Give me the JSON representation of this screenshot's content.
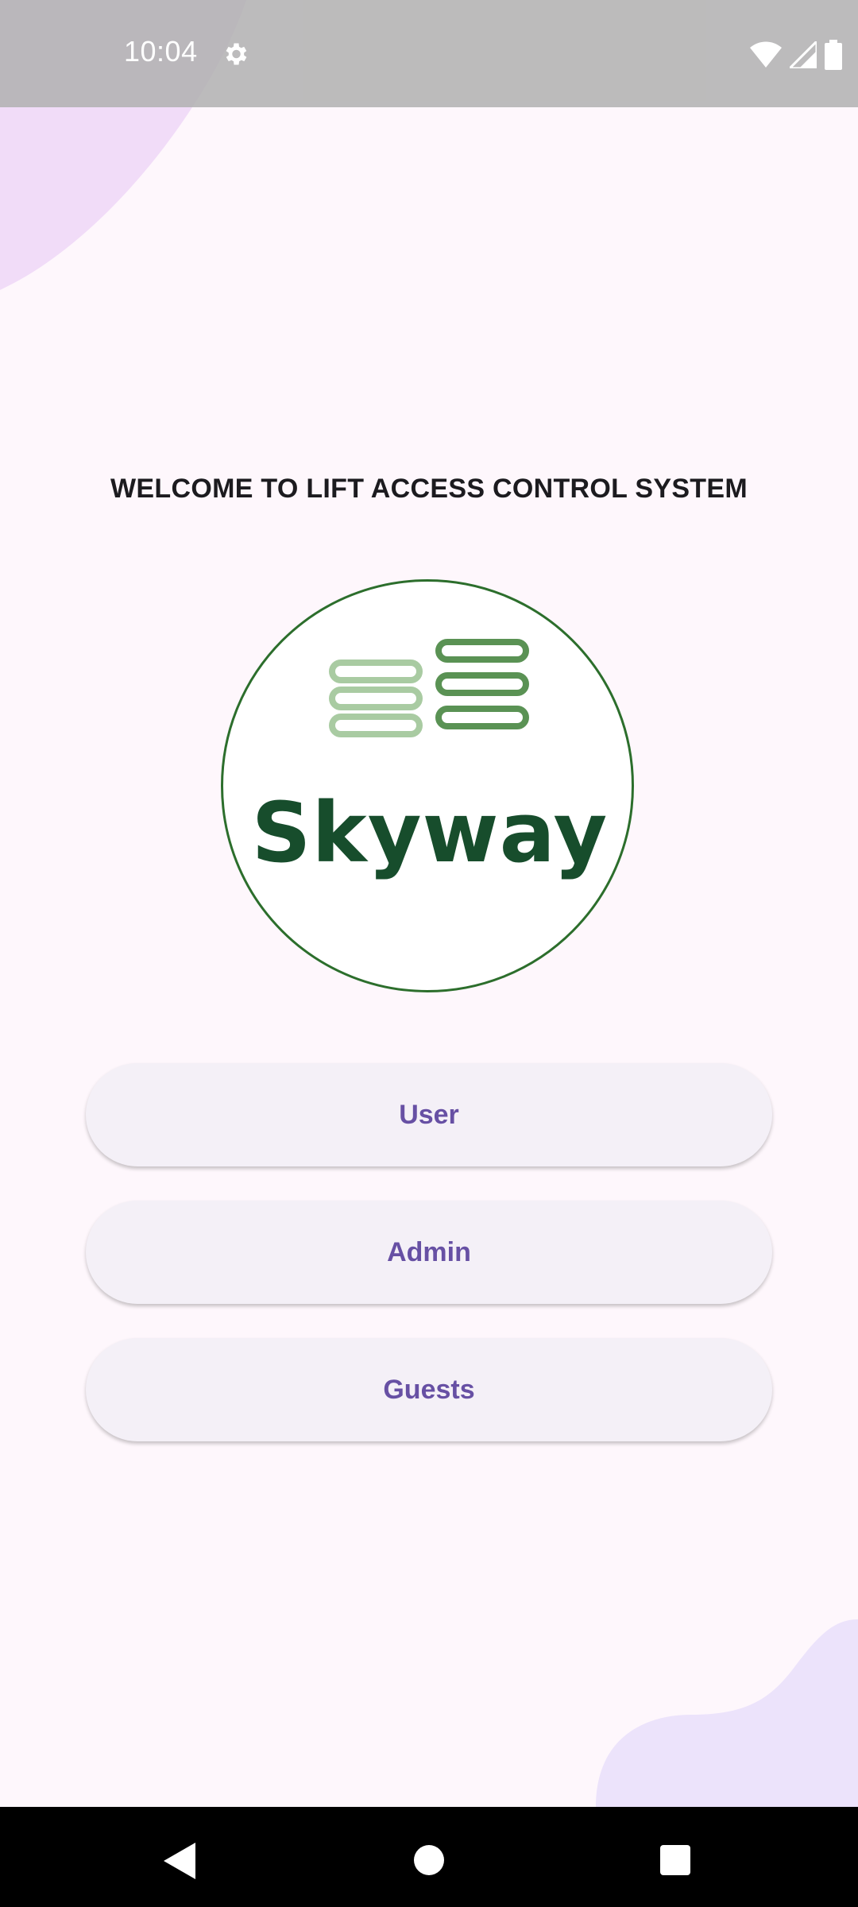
{
  "status_bar": {
    "time": "10:04",
    "icons": [
      "gear-icon",
      "wifi-icon",
      "signal-icon",
      "battery-icon"
    ]
  },
  "welcome_title": "WELCOME TO LIFT ACCESS CONTROL SYSTEM",
  "logo": {
    "brand_text": "Skyway",
    "colors": {
      "ring": "#2c6e2c",
      "text": "#174d2c",
      "bars_dark": "#5a9254",
      "bars_light": "#a9cba2"
    }
  },
  "buttons": {
    "user": "User",
    "admin": "Admin",
    "guests": "Guests"
  },
  "nav_bar": {
    "icons": [
      "back-icon",
      "home-icon",
      "recents-icon"
    ]
  },
  "theme": {
    "background": "#fef7fc",
    "button_bg": "#f4f0f7",
    "button_text": "#6750a4",
    "blob_top": "#f1dcf8",
    "blob_bottom": "#ece3fb"
  }
}
